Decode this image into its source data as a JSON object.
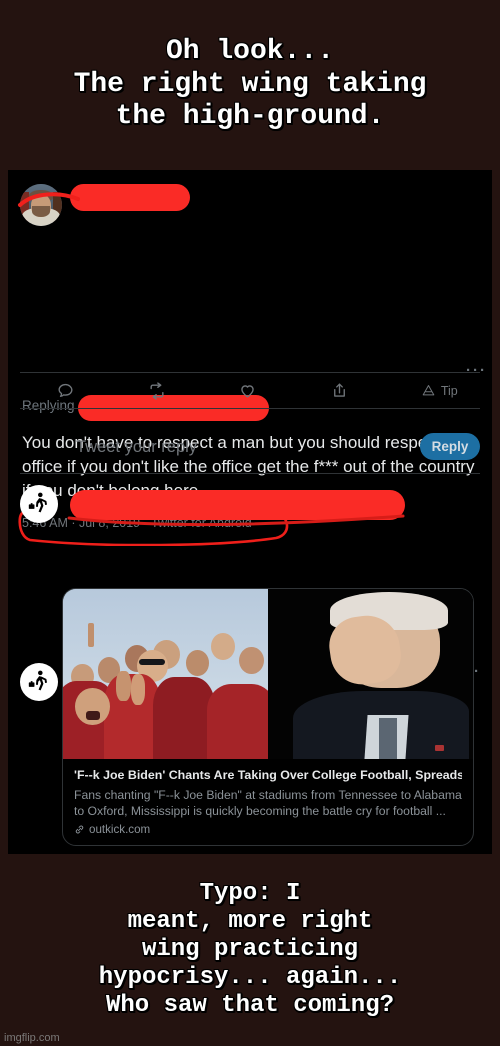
{
  "meme": {
    "top_caption": "Oh look...\nThe right wing taking\nthe high-ground.",
    "bottom_caption": "Typo: I\nmeant, more right\nwing practicing\nhypocrisy... again...\nWho saw that coming?",
    "watermark": "imgflip.com",
    "background_color": "#241310",
    "text_color": "#ffffff"
  },
  "tweet_panel": {
    "background_color": "#000000",
    "primary_tweet": {
      "avatar": "user-photo-avatar",
      "author_name_redacted": true,
      "redaction_color": "#fa2b26",
      "replying_label": "Replying",
      "body": "You don't have to respect a man but you should respect the office if you don't like the office get the f*** out of the country if you don't belong here",
      "timestamp": "5:46 AM · Jul 8, 2019 · Twitter for Android",
      "timestamp_circled": true,
      "overflow_menu": "···",
      "actions": [
        {
          "name": "reply",
          "icon": "comment-icon",
          "count": ""
        },
        {
          "name": "retweet",
          "icon": "retweet-icon",
          "count": ""
        },
        {
          "name": "like",
          "icon": "heart-icon",
          "count": ""
        },
        {
          "name": "share",
          "icon": "share-icon",
          "count": ""
        },
        {
          "name": "tip",
          "icon": "tip-icon",
          "count": "Tip"
        }
      ]
    },
    "composer": {
      "avatar": "pedestrian-icon-avatar",
      "placeholder": "Tweet your reply",
      "button_label": "Reply",
      "button_color": "#1d6fa3"
    },
    "reply_tweet": {
      "avatar": "pedestrian-icon-avatar",
      "author_name_redacted": true,
      "overflow_menu": "···",
      "body": "You don't have to respect a man but you should respect the office if you don't like the office get the f*** out of the country if you don't belong here",
      "link_card": {
        "media_left": "crowd-of-fans-chanting",
        "media_right": "man-facepalming",
        "title": "'F--k Joe Biden' Chants Are Taking Over College Football, Spreads To ...",
        "description": "Fans chanting \"F--k Joe Biden\" at stadiums from Tennessee to Alabama to Oxford, Mississippi is quickly becoming the battle cry for football ...",
        "domain": "outkick.com",
        "link_icon": "link-icon"
      }
    }
  }
}
